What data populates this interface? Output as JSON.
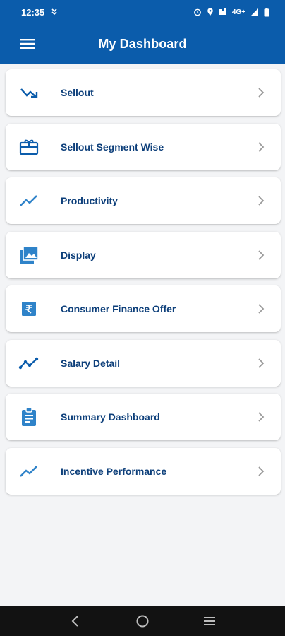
{
  "status_bar": {
    "time": "12:35",
    "network": "4G+"
  },
  "app_bar": {
    "title": "My Dashboard",
    "menu_icon": "hamburger-menu-icon"
  },
  "colors": {
    "primary": "#0b5cab",
    "label": "#0d3f7a",
    "icon": "#2f83c9"
  },
  "menu": [
    {
      "label": "Sellout",
      "icon": "trending-arrow-icon"
    },
    {
      "label": "Sellout Segment Wise",
      "icon": "gift-box-icon"
    },
    {
      "label": "Productivity",
      "icon": "trending-up-icon"
    },
    {
      "label": "Display",
      "icon": "image-gallery-icon"
    },
    {
      "label": "Consumer Finance Offer",
      "icon": "rupee-icon"
    },
    {
      "label": "Salary Detail",
      "icon": "line-chart-icon"
    },
    {
      "label": "Summary Dashboard",
      "icon": "clipboard-icon"
    },
    {
      "label": "Incentive Performance",
      "icon": "trending-up-icon"
    }
  ],
  "nav_bar": {
    "back_icon": "back-icon",
    "home_icon": "home-icon",
    "recents_icon": "recents-menu-icon"
  }
}
